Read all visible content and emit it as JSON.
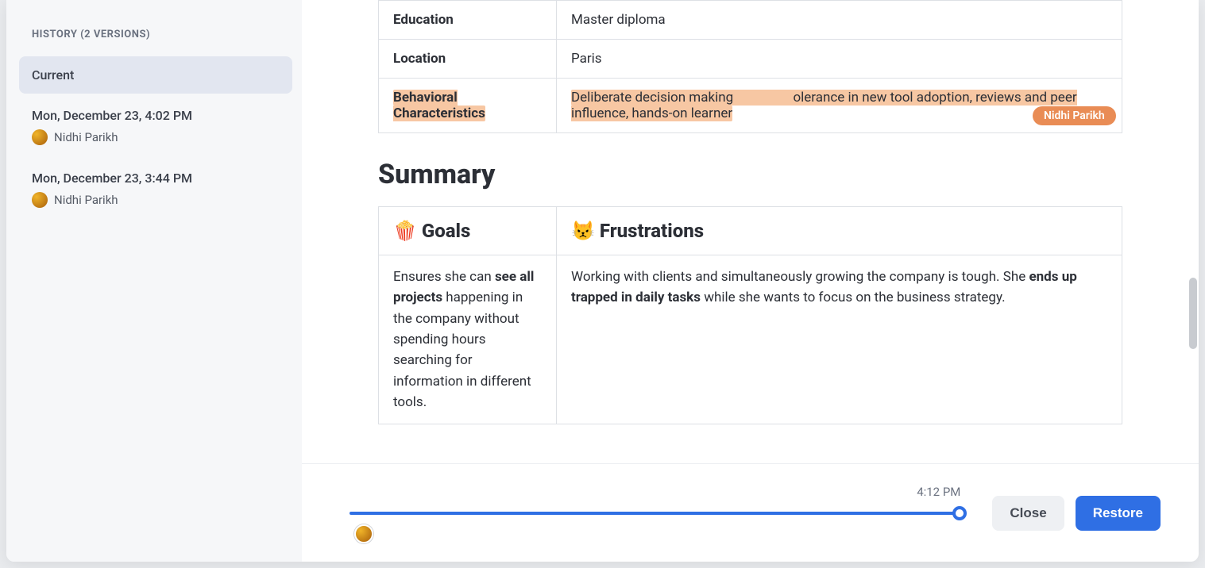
{
  "sidebar": {
    "title": "HISTORY (2 VERSIONS)",
    "items": [
      {
        "label": "Current",
        "active": true
      },
      {
        "label": "Mon, December 23, 4:02 PM",
        "user": "Nidhi Parikh"
      },
      {
        "label": "Mon, December 23, 3:44 PM",
        "user": "Nidhi Parikh"
      }
    ]
  },
  "profile_rows": {
    "education": {
      "label": "Education",
      "value": "Master diploma"
    },
    "location": {
      "label": "Location",
      "value": "Paris"
    },
    "behavioral": {
      "label": "Behavioral Characteristics",
      "value_pre": "Deliberate decision making",
      "value_post": "olerance in new tool adoption, reviews and peer influence, hands-on learner"
    }
  },
  "annotation": {
    "author": "Nidhi Parikh"
  },
  "summary": {
    "heading": "Summary",
    "goals_header": "🍿 Goals",
    "frustrations_header": "😾 Frustrations",
    "goals_pre": "Ensures she can ",
    "goals_bold": "see all projects",
    "goals_post": " happening in the company without spending hours searching for information in different tools.",
    "frust_pre": "Working with clients and simultaneously growing the company is tough. She ",
    "frust_bold": "ends up trapped in daily tasks",
    "frust_post": " while she wants to focus on the business strategy."
  },
  "footer": {
    "time": "4:12 PM",
    "close": "Close",
    "restore": "Restore"
  }
}
